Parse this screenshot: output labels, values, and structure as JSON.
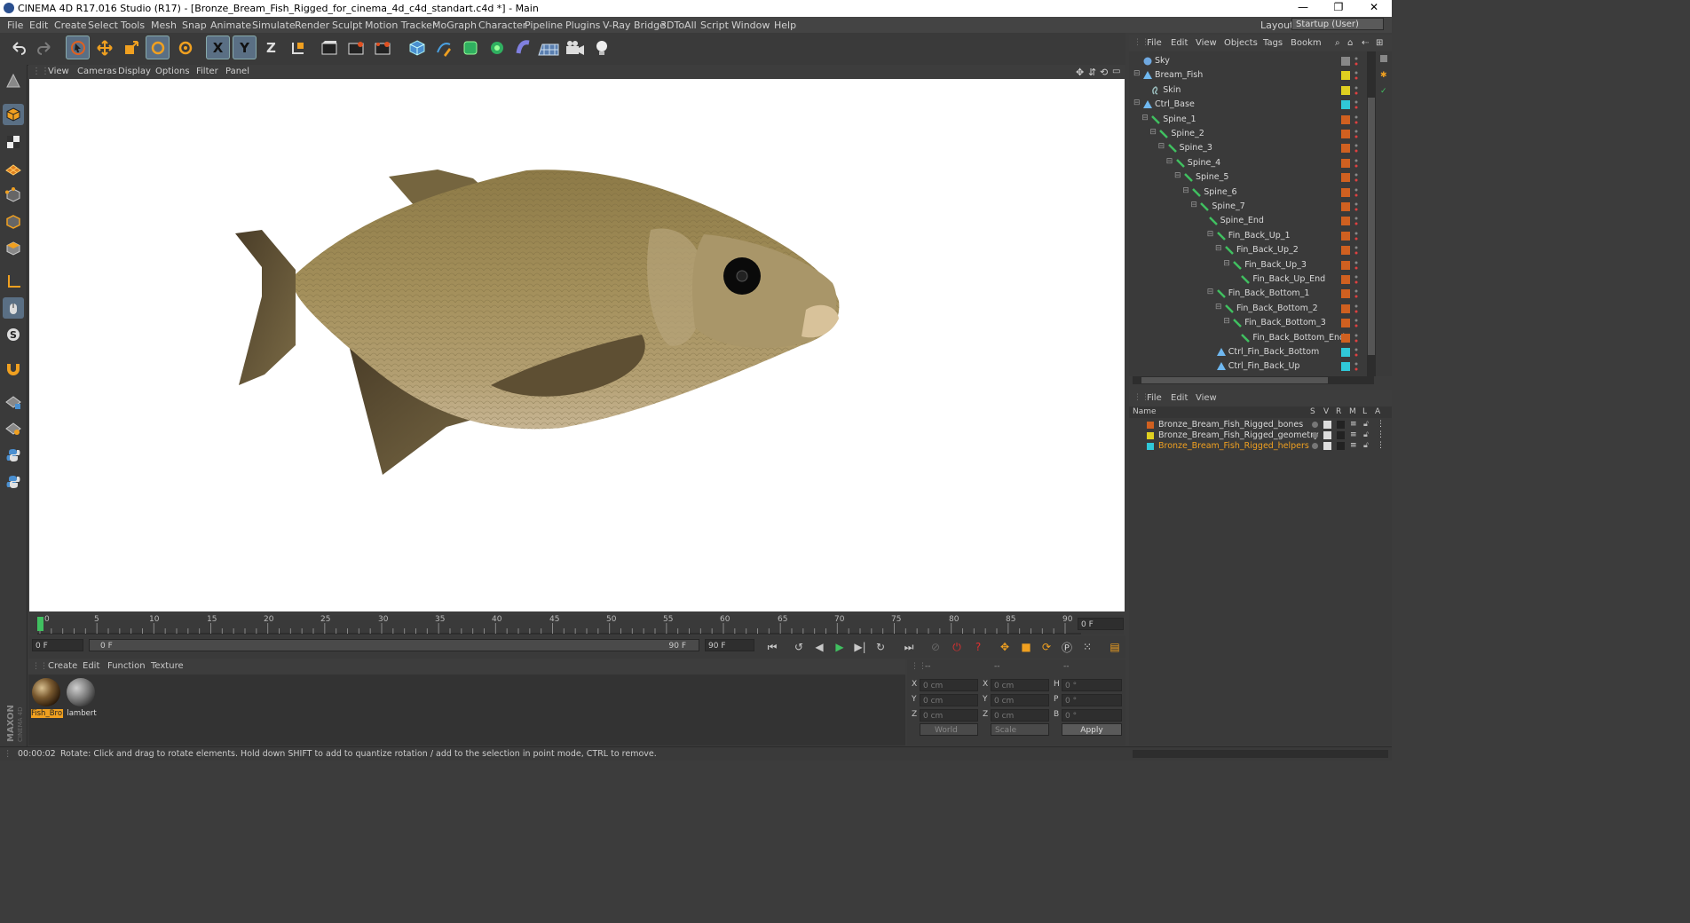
{
  "window": {
    "title": "CINEMA 4D R17.016 Studio (R17) - [Bronze_Bream_Fish_Rigged_for_cinema_4d_c4d_standart.c4d *] - Main",
    "minimize": "—",
    "restore": "❐",
    "close": "✕"
  },
  "menubar": {
    "items": [
      "File",
      "Edit",
      "Create",
      "Select",
      "Tools",
      "Mesh",
      "Snap",
      "Animate",
      "Simulate",
      "Render",
      "Sculpt",
      "Motion Tracker",
      "MoGraph",
      "Character",
      "Pipeline",
      "Plugins",
      "V-Ray Bridge",
      "3DToAll",
      "Script",
      "Window",
      "Help"
    ],
    "layout_label": "Layout:",
    "layout_value": "Startup (User)"
  },
  "toolbar": {
    "x_axis": "X",
    "y_axis": "Y",
    "z_axis": "Z"
  },
  "viewport": {
    "menu": [
      "View",
      "Cameras",
      "Display",
      "Options",
      "Filter",
      "Panel"
    ]
  },
  "timeline": {
    "ticks": [
      "0",
      "5",
      "10",
      "15",
      "20",
      "25",
      "30",
      "35",
      "40",
      "45",
      "50",
      "55",
      "60",
      "65",
      "70",
      "75",
      "80",
      "85",
      "90"
    ],
    "current_frame": "0 F"
  },
  "transport": {
    "start_field": "0 F",
    "range_start": "0 F",
    "range_end": "90 F",
    "end_field": "90 F"
  },
  "material_manager": {
    "menu": [
      "Create",
      "Edit",
      "Function",
      "Texture"
    ],
    "materials": [
      {
        "name": "Fish_Bro"
      },
      {
        "name": "lambert"
      }
    ]
  },
  "coordinates": {
    "header": [
      "--",
      "--",
      "--"
    ],
    "rows": [
      {
        "a": "X",
        "av": "0 cm",
        "b": "X",
        "bv": "0 cm",
        "c": "H",
        "cv": "0 °"
      },
      {
        "a": "Y",
        "av": "0 cm",
        "b": "Y",
        "bv": "0 cm",
        "c": "P",
        "cv": "0 °"
      },
      {
        "a": "Z",
        "av": "0 cm",
        "b": "Z",
        "bv": "0 cm",
        "c": "B",
        "cv": "0 °"
      }
    ],
    "mode": "World",
    "type": "Scale",
    "apply": "Apply"
  },
  "status": {
    "time": "00:00:02",
    "message": "Rotate: Click and drag to rotate elements. Hold down SHIFT to add to quantize rotation / add to the selection in point mode, CTRL to remove."
  },
  "object_manager": {
    "menu": [
      "File",
      "Edit",
      "View",
      "Objects",
      "Tags",
      "Bookm"
    ],
    "objects": [
      {
        "name": "Sky",
        "depth": 0,
        "type": "sky",
        "tag": "#888888"
      },
      {
        "name": "Bream_Fish",
        "depth": 0,
        "type": "null",
        "tag": "#e0d020"
      },
      {
        "name": "Skin",
        "depth": 1,
        "type": "skin",
        "tag": "#e0d020"
      },
      {
        "name": "Ctrl_Base",
        "depth": 0,
        "type": "null",
        "tag": "#30c8d8"
      },
      {
        "name": "Spine_1",
        "depth": 1,
        "type": "bone",
        "tag": "#d06020"
      },
      {
        "name": "Spine_2",
        "depth": 2,
        "type": "bone",
        "tag": "#d06020"
      },
      {
        "name": "Spine_3",
        "depth": 3,
        "type": "bone",
        "tag": "#d06020"
      },
      {
        "name": "Spine_4",
        "depth": 4,
        "type": "bone",
        "tag": "#d06020"
      },
      {
        "name": "Spine_5",
        "depth": 5,
        "type": "bone",
        "tag": "#d06020"
      },
      {
        "name": "Spine_6",
        "depth": 6,
        "type": "bone",
        "tag": "#d06020"
      },
      {
        "name": "Spine_7",
        "depth": 7,
        "type": "bone",
        "tag": "#d06020"
      },
      {
        "name": "Spine_End",
        "depth": 8,
        "type": "bone",
        "tag": "#d06020"
      },
      {
        "name": "Fin_Back_Up_1",
        "depth": 9,
        "type": "bone",
        "tag": "#d06020"
      },
      {
        "name": "Fin_Back_Up_2",
        "depth": 10,
        "type": "bone",
        "tag": "#d06020"
      },
      {
        "name": "Fin_Back_Up_3",
        "depth": 11,
        "type": "bone",
        "tag": "#d06020"
      },
      {
        "name": "Fin_Back_Up_End",
        "depth": 12,
        "type": "bone",
        "tag": "#d06020"
      },
      {
        "name": "Fin_Back_Bottom_1",
        "depth": 9,
        "type": "bone",
        "tag": "#d06020"
      },
      {
        "name": "Fin_Back_Bottom_2",
        "depth": 10,
        "type": "bone",
        "tag": "#d06020"
      },
      {
        "name": "Fin_Back_Bottom_3",
        "depth": 11,
        "type": "bone",
        "tag": "#d06020"
      },
      {
        "name": "Fin_Back_Bottom_End",
        "depth": 12,
        "type": "bone",
        "tag": "#d06020"
      },
      {
        "name": "Ctrl_Fin_Back_Bottom",
        "depth": 9,
        "type": "null",
        "tag": "#30c8d8"
      },
      {
        "name": "Ctrl_Fin_Back_Up",
        "depth": 9,
        "type": "null",
        "tag": "#30c8d8"
      }
    ]
  },
  "layer_manager": {
    "menu": [
      "File",
      "Edit",
      "View"
    ],
    "columns": [
      "Name",
      "S",
      "V",
      "R",
      "M",
      "L",
      "A"
    ],
    "layers": [
      {
        "name": "Bronze_Bream_Fish_Rigged_bones",
        "color": "#d06020",
        "text_color": "#d8d8d8"
      },
      {
        "name": "Bronze_Bream_Fish_Rigged_geometry",
        "color": "#e0d020",
        "text_color": "#d8d8d8"
      },
      {
        "name": "Bronze_Bream_Fish_Rigged_helpers",
        "color": "#30c8d8",
        "text_color": "#f0a020"
      }
    ]
  },
  "colors": {
    "ui_bg": "#3c3c3c",
    "accent_selected": "#5a6f84",
    "fish_body": "#a08a55"
  }
}
